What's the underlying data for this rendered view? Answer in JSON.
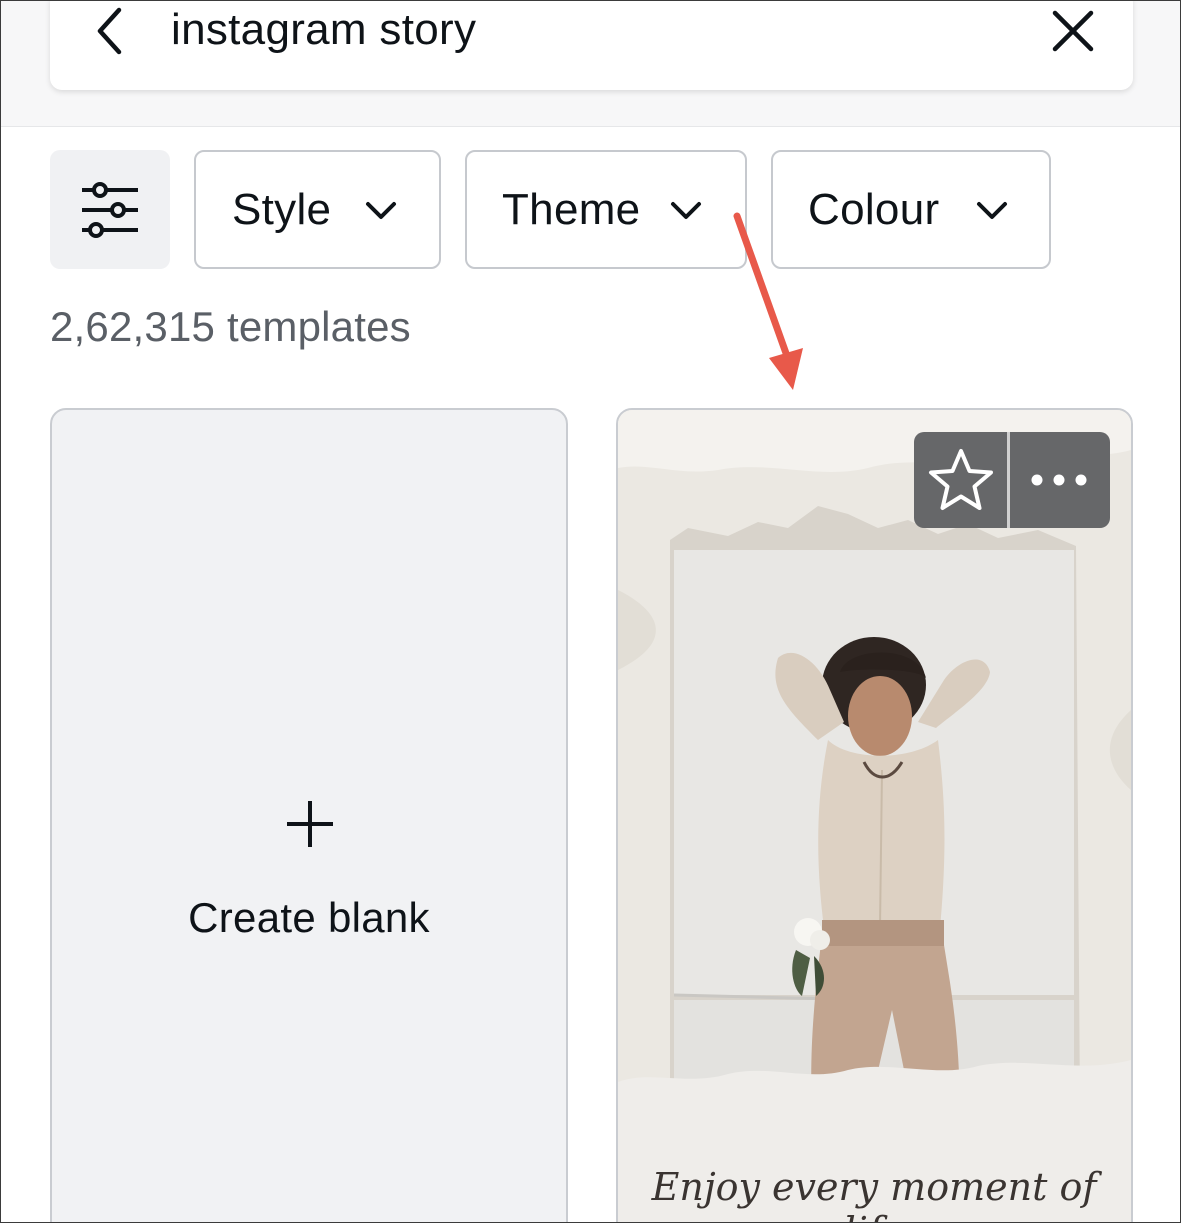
{
  "search": {
    "query": "instagram story"
  },
  "filters": {
    "style_label": "Style",
    "theme_label": "Theme",
    "colour_label": "Colour"
  },
  "results": {
    "count_label": "2,62,315 templates"
  },
  "blank_card": {
    "label": "Create blank"
  },
  "template_card": {
    "caption_line1": "Enjoy every moment of",
    "caption_line2": "life"
  },
  "icons": {
    "back": "chevron-left-icon",
    "clear": "close-icon",
    "filter": "sliders-icon",
    "dropdown": "chevron-down-icon",
    "add": "plus-icon",
    "favorite": "star-icon",
    "more": "more-horizontal-icon"
  },
  "colors": {
    "annotation_arrow": "#e8594a",
    "action_bar": "#666769",
    "chip_border": "#c6c9ce",
    "muted_text": "#5a5f66"
  }
}
